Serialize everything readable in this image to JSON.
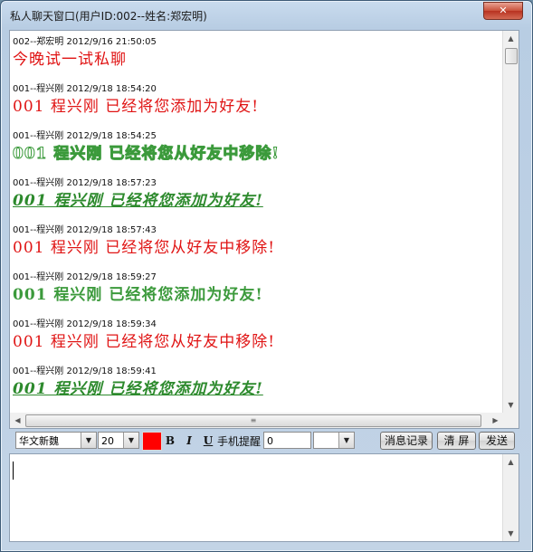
{
  "window": {
    "title": "私人聊天窗口(用户ID:002--姓名:郑宏明)",
    "close_label": "✕"
  },
  "messages": [
    {
      "meta": "002--郑宏明  2012/9/16  21:50:05",
      "text": "今晚试一试私聊",
      "style": "red"
    },
    {
      "meta": "001--程兴刚  2012/9/18  18:54:20",
      "text": "001 程兴刚 已经将您添加为好友!",
      "style": "red"
    },
    {
      "meta": "001--程兴刚  2012/9/18  18:54:25",
      "text": "001 程兴刚 已经将您从好友中移除!",
      "style": "green-outline"
    },
    {
      "meta": "001--程兴刚  2012/9/18  18:57:23",
      "text": "001 程兴刚 已经将您添加为好友!",
      "style": "green-bi"
    },
    {
      "meta": "001--程兴刚  2012/9/18  18:57:43",
      "text": "001 程兴刚 已经将您从好友中移除!",
      "style": "red"
    },
    {
      "meta": "001--程兴刚  2012/9/18  18:59:27",
      "text": "001 程兴刚 已经将您添加为好友!",
      "style": "green"
    },
    {
      "meta": "001--程兴刚  2012/9/18  18:59:34",
      "text": "001 程兴刚 已经将您从好友中移除!",
      "style": "red"
    },
    {
      "meta": "001--程兴刚  2012/9/18  18:59:41",
      "text": "001 程兴刚 已经将您添加为好友!",
      "style": "green-bi"
    }
  ],
  "toolbar": {
    "font_value": "华文新魏",
    "size_value": "20",
    "color": "#ff0000",
    "bold_label": "B",
    "italic_label": "I",
    "underline_label": "U",
    "mobile_remind_label": "手机提醒",
    "mobile_value": "0",
    "history_label": "消息记录",
    "clear_label": "清 屏",
    "send_label": "发送"
  },
  "input": {
    "value": ""
  },
  "colors": {
    "red_text": "#e01414",
    "green_text": "#3c9a3c",
    "title_bg": "#b8cde3"
  }
}
